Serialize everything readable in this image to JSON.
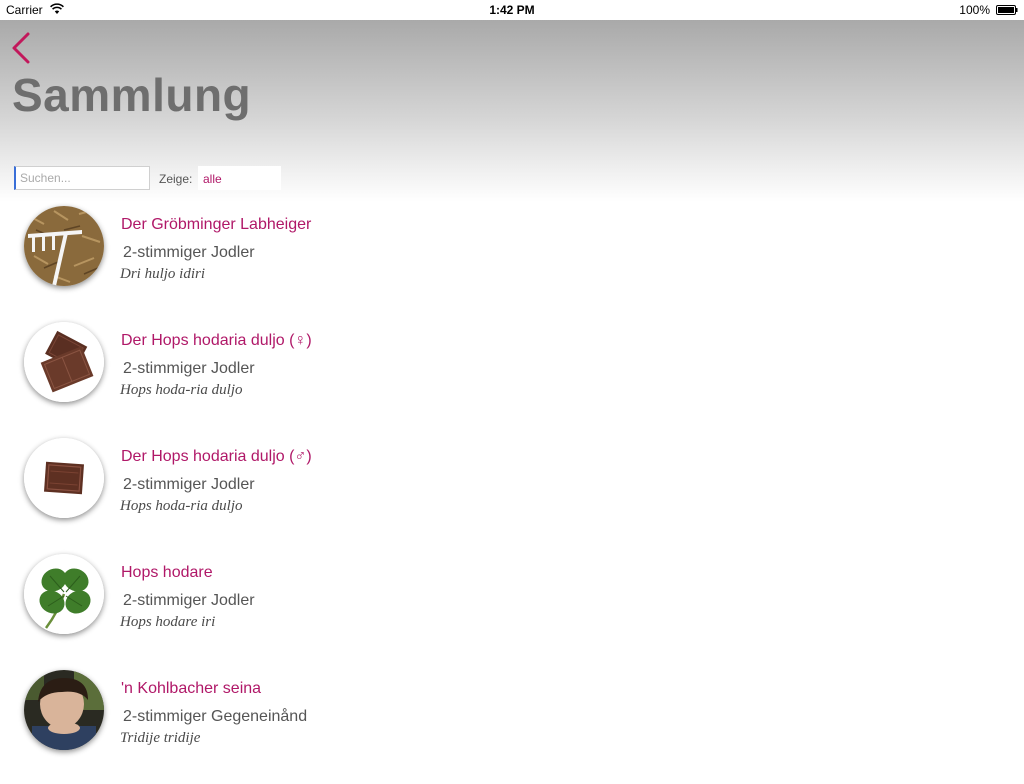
{
  "status_bar": {
    "carrier": "Carrier",
    "time": "1:42 PM",
    "battery": "100%",
    "wifi_icon": "wifi-icon",
    "battery_icon": "battery-icon"
  },
  "header": {
    "back_icon": "chevron-left-icon",
    "title": "Sammlung"
  },
  "filters": {
    "search_placeholder": "Suchen...",
    "search_value": "",
    "show_label": "Zeige:",
    "show_value": "alle"
  },
  "colors": {
    "accent": "#b01868",
    "title_gray": "#6e6e6e",
    "subtitle_gray": "#555555"
  },
  "songs": [
    {
      "title": "Der Gröbminger Labheiger",
      "type": "2-stimmiger Jodler",
      "lyric": "Dri huljo idiri",
      "thumbnail": "hay-rake-image"
    },
    {
      "title": "Der Hops hodaria duljo (♀)",
      "type": "2-stimmiger Jodler",
      "lyric": "Hops hoda-ria duljo",
      "thumbnail": "chocolate-pieces-image"
    },
    {
      "title": "Der Hops hodaria duljo (♂)",
      "type": "2-stimmiger Jodler",
      "lyric": "Hops hoda-ria duljo",
      "thumbnail": "chocolate-piece-image"
    },
    {
      "title": "Hops hodare",
      "type": "2-stimmiger Jodler",
      "lyric": "Hops hodare iri",
      "thumbnail": "four-leaf-clover-image"
    },
    {
      "title": "'n Kohlbacher seina",
      "type": "2-stimmiger Gegeneinånd",
      "lyric": "Tridije tridije",
      "thumbnail": "boy-portrait-image"
    }
  ]
}
